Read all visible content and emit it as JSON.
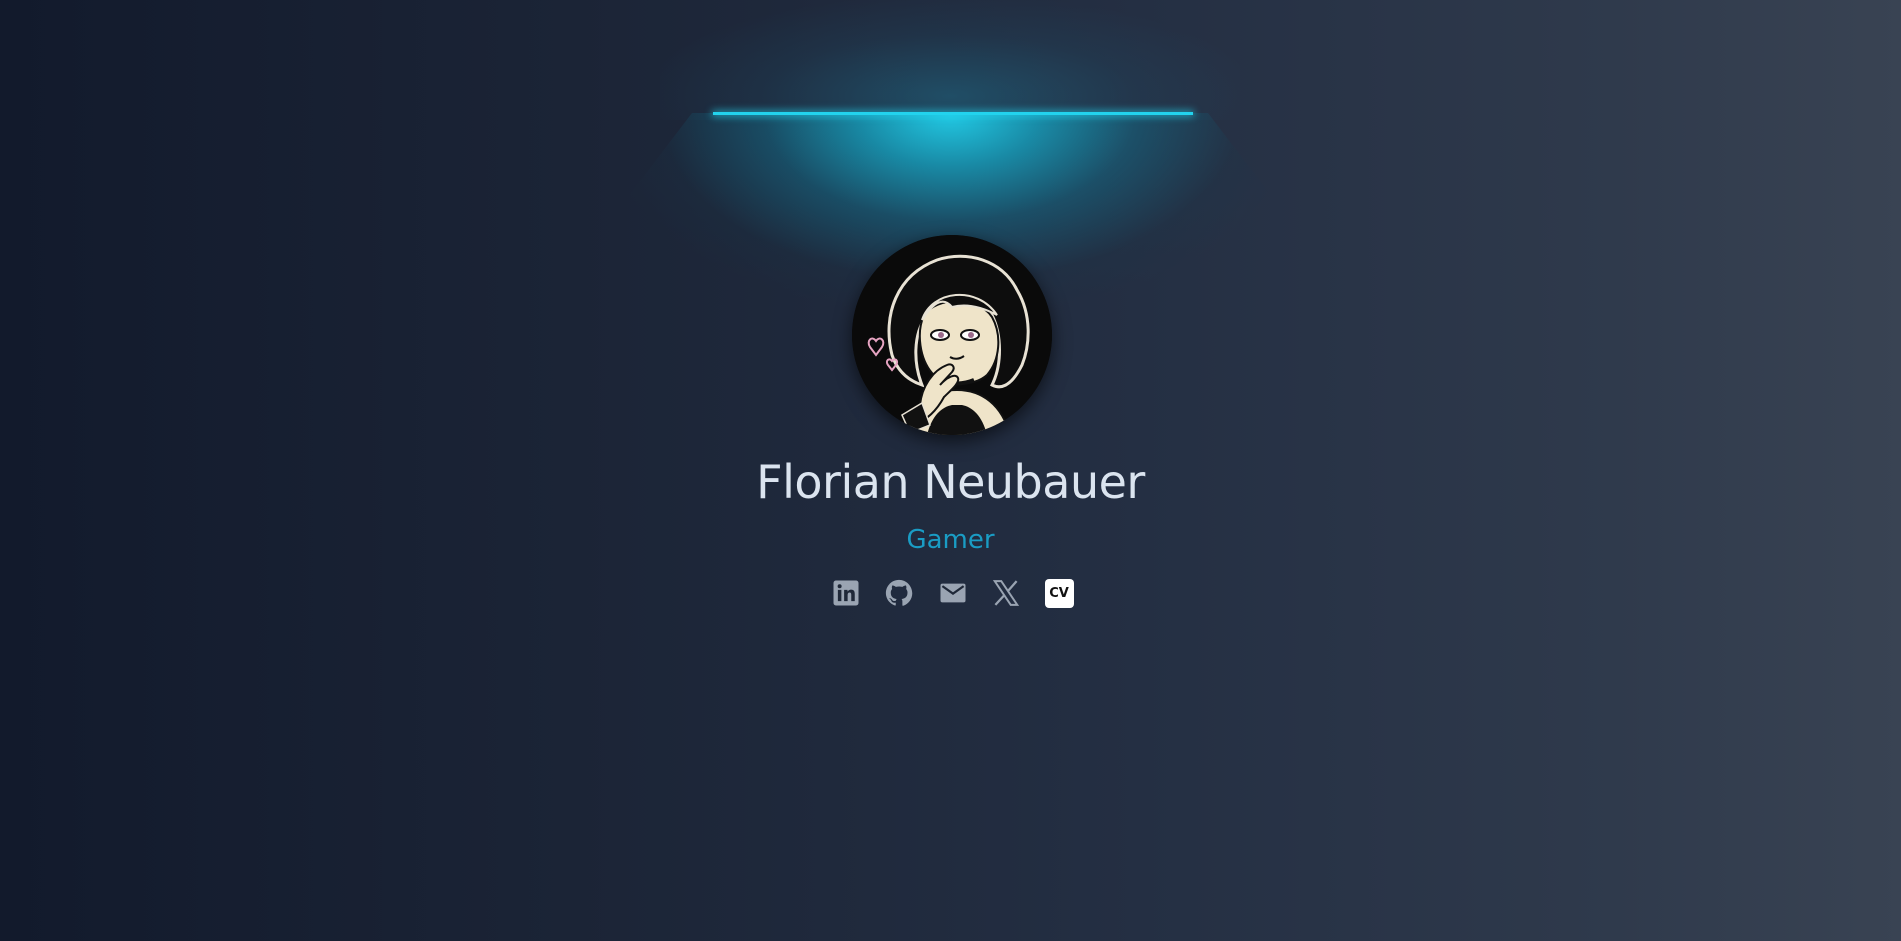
{
  "profile": {
    "name": "Florian Neubauer",
    "role": "Gamer"
  },
  "theme": {
    "accent": "#22d3ee",
    "role_color": "#1a9cc4",
    "name_color": "#dbe4ef",
    "icon_color": "#9aa4b2"
  },
  "links": [
    {
      "icon": "linkedin-icon"
    },
    {
      "icon": "github-icon"
    },
    {
      "icon": "mail-icon"
    },
    {
      "icon": "x-icon"
    },
    {
      "icon": "cv-icon",
      "label": "CV"
    }
  ]
}
